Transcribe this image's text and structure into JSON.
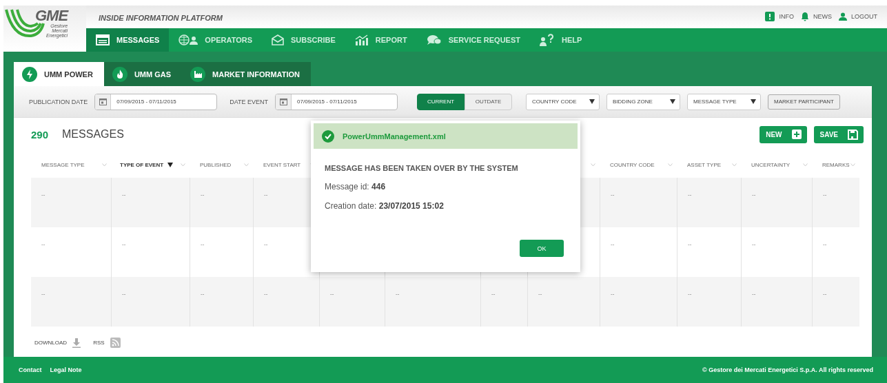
{
  "header": {
    "logo": {
      "name": "GME",
      "subtitle": [
        "Gestore",
        "Mercati",
        "Energetici"
      ]
    },
    "title": "INSIDE INFORMATION PLATFORM",
    "links": [
      {
        "label": "INFO"
      },
      {
        "label": "NEWS"
      },
      {
        "label": "LOGOUT"
      }
    ]
  },
  "nav": [
    {
      "label": "MESSAGES",
      "selected": true
    },
    {
      "label": "OPERATORS",
      "selected": false
    },
    {
      "label": "SUBSCRIBE",
      "selected": false
    },
    {
      "label": "REPORT",
      "selected": false
    },
    {
      "label": "SERVICE REQUEST",
      "selected": false
    },
    {
      "label": "HELP",
      "selected": false
    }
  ],
  "tabs": [
    {
      "label": "UMM POWER",
      "selected": true
    },
    {
      "label": "UMM GAS",
      "selected": false
    },
    {
      "label": "MARKET INFORMATION",
      "selected": false
    }
  ],
  "filters": [
    {
      "kind": "date",
      "label": "PUBLICATION DATE",
      "value": "07/09/2015 - 07/11/2015"
    },
    {
      "kind": "date",
      "label": "DATE EVENT",
      "value": "07/09/2015 - 07/11/2015"
    },
    {
      "kind": "toggle",
      "options": [
        {
          "label": "CURRENT",
          "selected": true
        },
        {
          "label": "OUTDATE",
          "selected": false
        }
      ]
    },
    {
      "kind": "dropdown",
      "label": "COUNTRY CODE"
    },
    {
      "kind": "dropdown",
      "label": "BIDDING ZONE"
    },
    {
      "kind": "dropdown",
      "label": "MESSAGE TYPE"
    },
    {
      "kind": "button",
      "label": "MARKET PARTICIPANT"
    }
  ],
  "messages": {
    "count": "290",
    "title": "MESSAGES",
    "actions": [
      {
        "label": "NEW"
      },
      {
        "label": "SAVE"
      }
    ]
  },
  "table": {
    "columns": [
      {
        "label": "MESSAGE TYPE",
        "sorted": false
      },
      {
        "label": "TYPE OF EVENT",
        "sorted": true
      },
      {
        "label": "PUBLISHED",
        "sorted": false
      },
      {
        "label": "EVENT START",
        "sorted": false
      },
      {},
      {},
      {},
      {},
      {
        "label": "COUNTRY CODE",
        "sorted": false
      },
      {
        "label": "ASSET TYPE",
        "sorted": false
      },
      {
        "label": "UNCERTAINTY",
        "sorted": false
      },
      {
        "label": "REMARKS",
        "sorted": false
      }
    ],
    "rows": [
      {
        "cells": [
          "--",
          "--",
          "--",
          "--",
          null,
          null,
          null,
          null,
          "--",
          "--",
          "--",
          "--"
        ]
      },
      {
        "cells": [
          "--",
          "--",
          "--",
          "--",
          null,
          null,
          null,
          null,
          "--",
          "--",
          "--",
          "--"
        ]
      },
      {
        "cells": [
          "--",
          "--",
          "--",
          "--",
          "--",
          "--",
          "--",
          "--",
          "--",
          "--",
          "--",
          "--"
        ]
      }
    ]
  },
  "bottom_links": [
    {
      "label": "DOWNLOAD"
    },
    {
      "label": "RSS"
    }
  ],
  "footer": {
    "links": [
      "Contact",
      "Legal Note"
    ],
    "copyright": "© Gestore dei Mercati Energetici S.p.A.   All rights reserved"
  },
  "dialog": {
    "file": "PowerUmmManagement.xml",
    "title": "MESSAGE HAS BEEN TAKEN OVER BY THE SYSTEM",
    "lines": [
      "Message id: **446**",
      "Creation date:  **23/07/2015 15:02**"
    ],
    "button": "OK"
  }
}
